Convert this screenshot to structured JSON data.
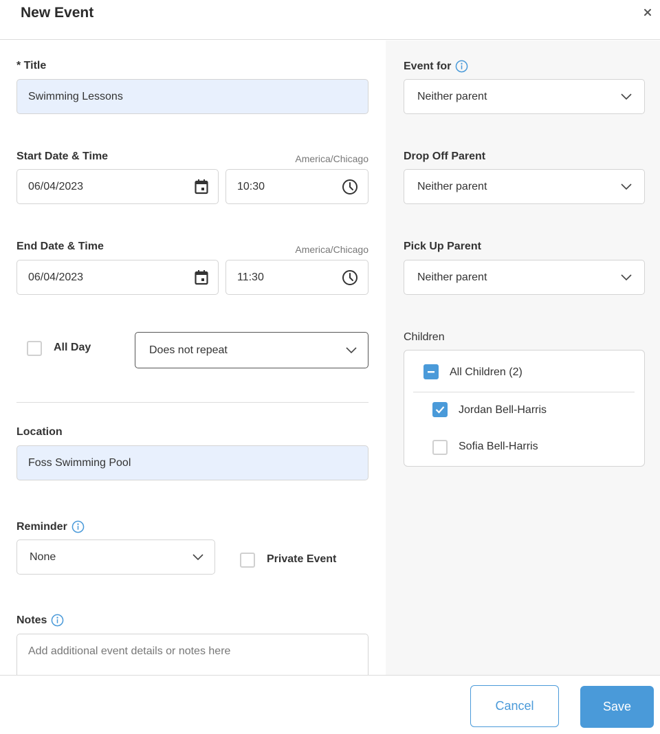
{
  "dialog": {
    "title": "New Event",
    "close_icon": "close-icon"
  },
  "form": {
    "title": {
      "label": "* Title",
      "value": "Swimming Lessons"
    },
    "start": {
      "label": "Start Date & Time",
      "timezone": "America/Chicago",
      "date": "06/04/2023",
      "time": "10:30"
    },
    "end": {
      "label": "End Date & Time",
      "timezone": "America/Chicago",
      "date": "06/04/2023",
      "time": "11:30"
    },
    "all_day": {
      "label": "All Day",
      "checked": false
    },
    "repeat": {
      "value": "Does not repeat"
    },
    "location": {
      "label": "Location",
      "value": "Foss Swimming Pool"
    },
    "reminder": {
      "label": "Reminder",
      "value": "None"
    },
    "private_event": {
      "label": "Private Event",
      "checked": false
    },
    "notes": {
      "label": "Notes",
      "placeholder": "Add additional event details or notes here"
    }
  },
  "sidebar": {
    "event_for": {
      "label": "Event for",
      "value": "Neither parent"
    },
    "drop_off": {
      "label": "Drop Off Parent",
      "value": "Neither parent"
    },
    "pick_up": {
      "label": "Pick Up Parent",
      "value": "Neither parent"
    },
    "children": {
      "label": "Children",
      "all_label": "All Children (2)",
      "all_state": "indeterminate",
      "items": [
        {
          "name": "Jordan Bell-Harris",
          "checked": true
        },
        {
          "name": "Sofia Bell-Harris",
          "checked": false
        }
      ]
    }
  },
  "footer": {
    "cancel_label": "Cancel",
    "save_label": "Save"
  },
  "colors": {
    "accent": "#4a9ad9",
    "filled_field": "#e8f0fd",
    "sidebar_bg": "#f7f7f7"
  }
}
